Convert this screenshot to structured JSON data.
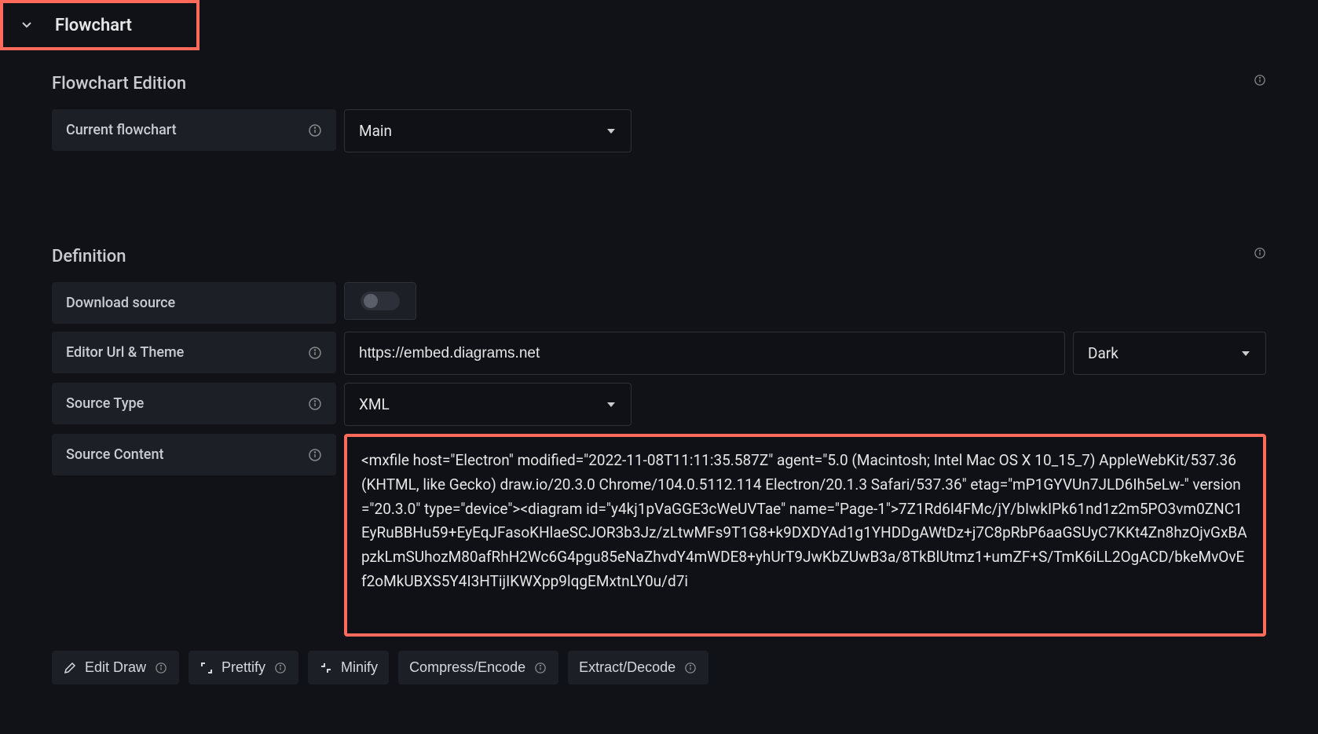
{
  "header": {
    "title": "Flowchart"
  },
  "groups": {
    "flowchart_edition": {
      "heading": "Flowchart Edition",
      "fields": {
        "current_flowchart": {
          "label": "Current flowchart",
          "value": "Main"
        }
      }
    },
    "definition": {
      "heading": "Definition",
      "fields": {
        "download_source": {
          "label": "Download source",
          "value": false
        },
        "editor_url_theme": {
          "label": "Editor Url & Theme",
          "url": "https://embed.diagrams.net",
          "theme": "Dark"
        },
        "source_type": {
          "label": "Source Type",
          "value": "XML"
        },
        "source_content": {
          "label": "Source Content",
          "value": "<mxfile host=\"Electron\" modified=\"2022-11-08T11:11:35.587Z\" agent=\"5.0 (Macintosh; Intel Mac OS X 10_15_7) AppleWebKit/537.36 (KHTML, like Gecko) draw.io/20.3.0 Chrome/104.0.5112.114 Electron/20.1.3 Safari/537.36\" etag=\"mP1GYVUn7JLD6Ih5eLw-\" version=\"20.3.0\" type=\"device\"><diagram id=\"y4kj1pVaGGE3cWeUVTae\" name=\"Page-1\">7Z1Rd6I4FMc/jY/bIwkIPk61nd1z2m5PO3vm0ZNC1EyRuBBHu59+EyEqJFasoKHlaeSCJOR3b3Jz/zLtwMFs9T1G8+k9DXDYAd1g1YHDDgAWtDz+j7C8pRbP6aaGSUyC7KKt4Zn8hzOjvGxBApzkLmSUhozM80afRhH2Wc6G4pgu85eNaZhvdY4mWDE8+yhUrT9JwKbZUwB3a/8TkBlUtmz1+umZF+S/TmK6iLL2OgACD/bkeMvOvEf2oMkUBXS5Y4I3HTijIKWXpp9lqgEMxtnLY0u/d7i"
        }
      }
    }
  },
  "buttons": {
    "edit_draw": "Edit Draw",
    "prettify": "Prettify",
    "minify": "Minify",
    "compress_encode": "Compress/Encode",
    "extract_decode": "Extract/Decode"
  }
}
